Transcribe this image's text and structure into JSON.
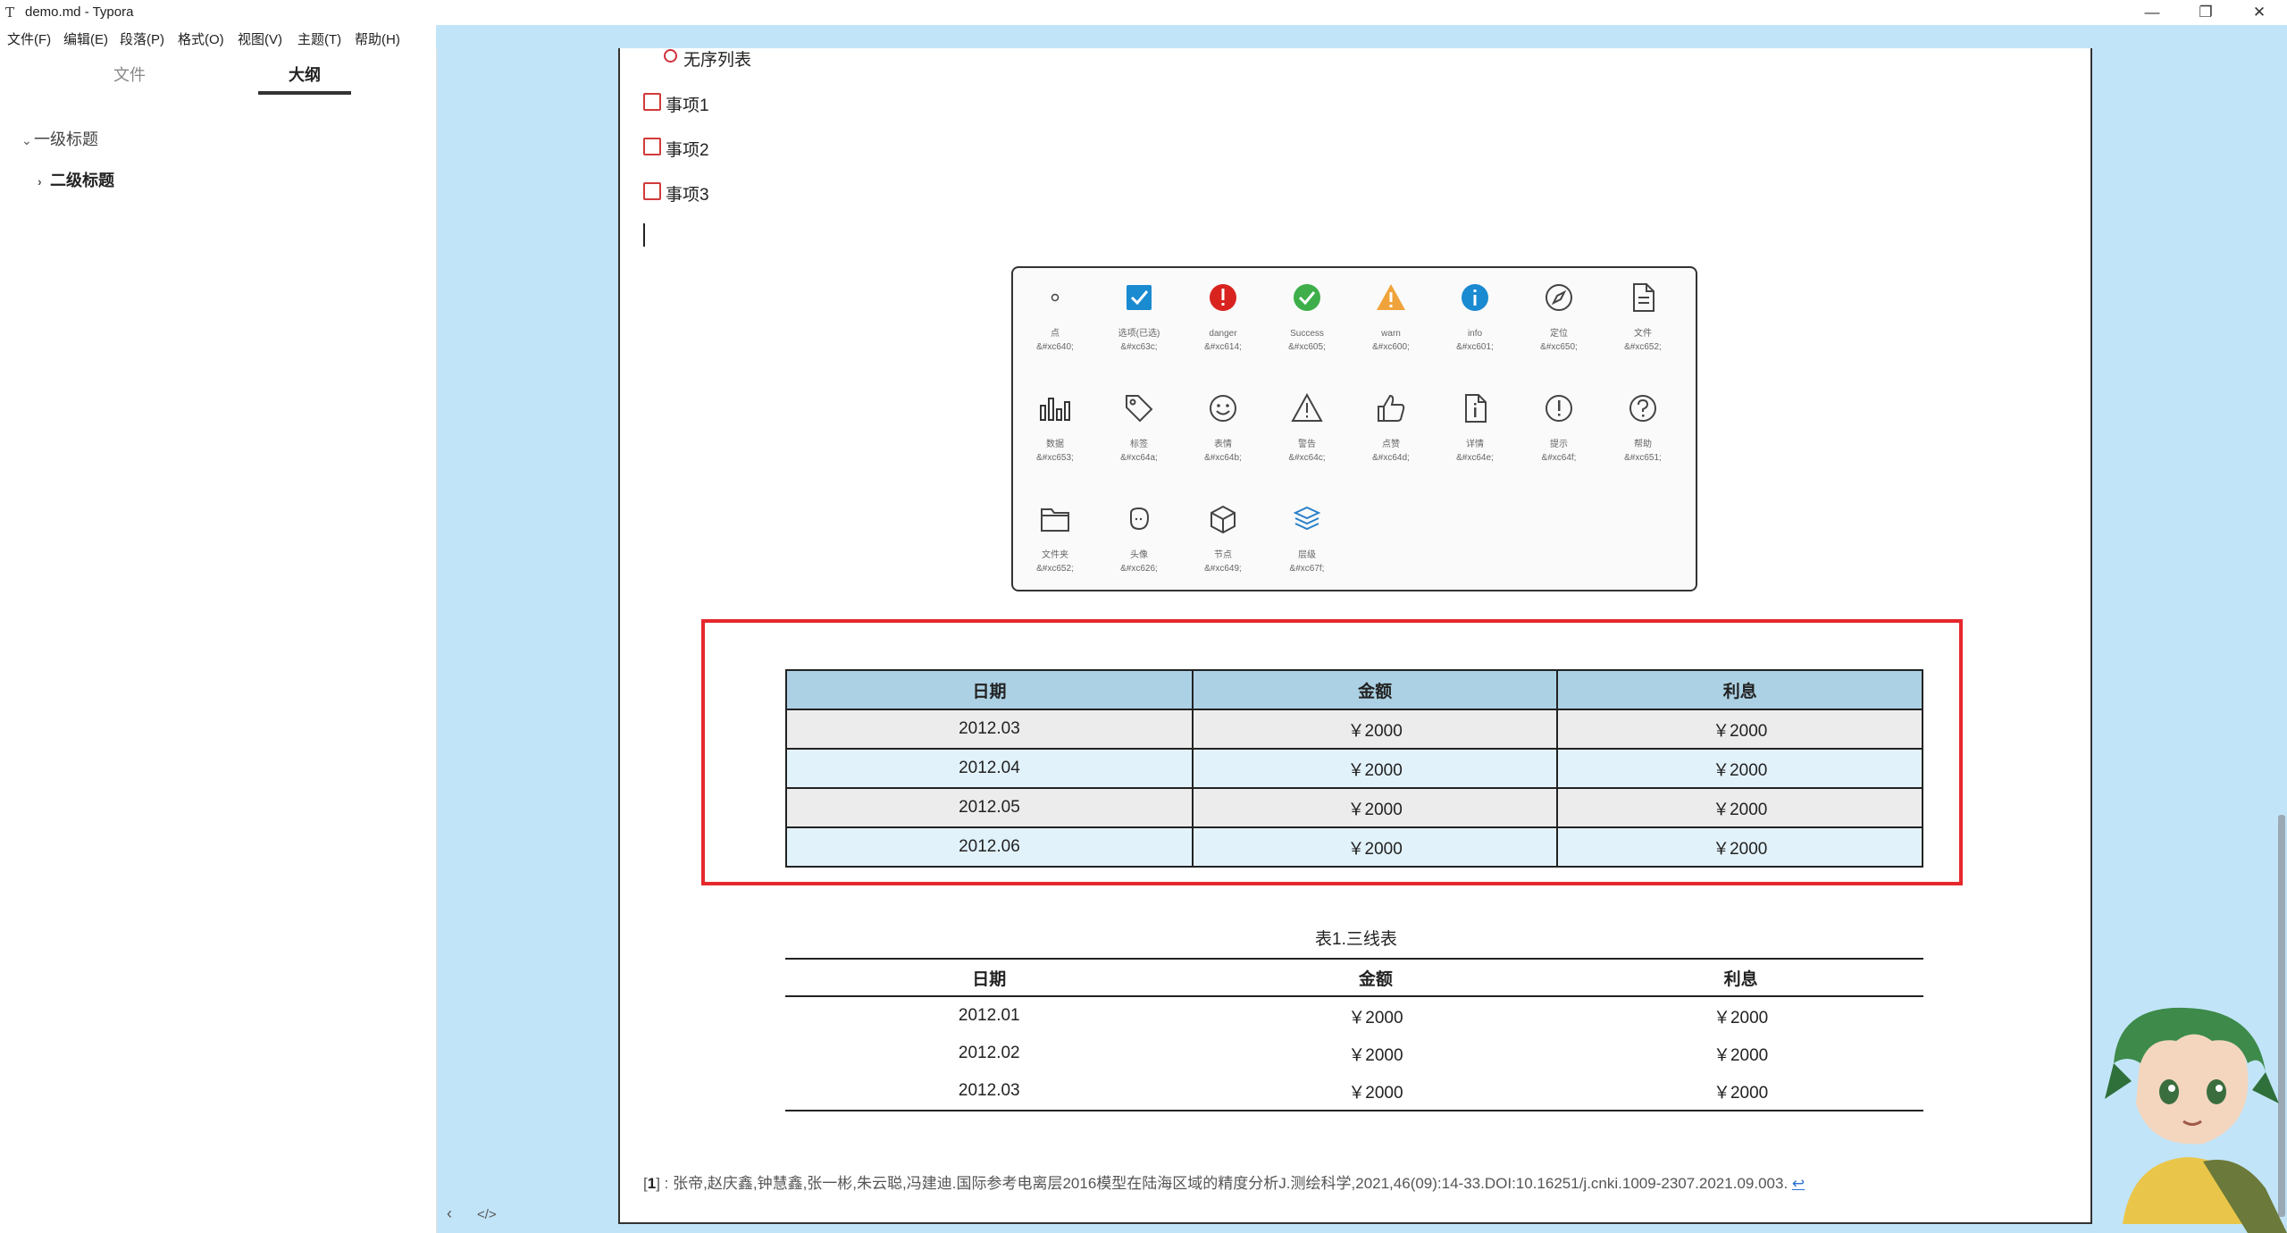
{
  "window": {
    "title": "demo.md - Typora",
    "app_icon": "T",
    "min_glyph": "—",
    "max_glyph": "❐",
    "close_glyph": "✕"
  },
  "menu": [
    "文件(F)",
    "编辑(E)",
    "段落(P)",
    "格式(O)",
    "视图(V)",
    "主题(T)",
    "帮助(H)"
  ],
  "sidebar": {
    "tabs": [
      "文件",
      "大纲"
    ],
    "active_tab": "大纲",
    "outline": [
      {
        "label": "一级标题",
        "chevron": "⌄"
      },
      {
        "label": "二级标题",
        "chevron": "›"
      }
    ],
    "footer_icons": [
      "‹",
      "</>"
    ]
  },
  "editor": {
    "unordered_item": "无序列表",
    "tasks": [
      "事项1",
      "事项2",
      "事项3"
    ],
    "gallery": [
      {
        "label": "点",
        "code": "&#xc640;"
      },
      {
        "label": "选项(已选)",
        "code": "&#xc63c;"
      },
      {
        "label": "danger",
        "code": "&#xc614;"
      },
      {
        "label": "Success",
        "code": "&#xc605;"
      },
      {
        "label": "warn",
        "code": "&#xc600;"
      },
      {
        "label": "info",
        "code": "&#xc601;"
      },
      {
        "label": "定位",
        "code": "&#xc650;"
      },
      {
        "label": "文件",
        "code": "&#xc652;"
      },
      {
        "label": "数据",
        "code": "&#xc653;"
      },
      {
        "label": "标签",
        "code": "&#xc64a;"
      },
      {
        "label": "表情",
        "code": "&#xc64b;"
      },
      {
        "label": "警告",
        "code": "&#xc64c;"
      },
      {
        "label": "点赞",
        "code": "&#xc64d;"
      },
      {
        "label": "详情",
        "code": "&#xc64e;"
      },
      {
        "label": "提示",
        "code": "&#xc64f;"
      },
      {
        "label": "帮助",
        "code": "&#xc651;"
      },
      {
        "label": "文件夹",
        "code": "&#xc652;"
      },
      {
        "label": "头像",
        "code": "&#xc626;"
      },
      {
        "label": "节点",
        "code": "&#xc649;"
      },
      {
        "label": "层级",
        "code": "&#xc67f;"
      }
    ],
    "table1": {
      "headers": [
        "日期",
        "金额",
        "利息"
      ],
      "rows": [
        [
          "2012.03",
          "￥2000",
          "￥2000"
        ],
        [
          "2012.04",
          "￥2000",
          "￥2000"
        ],
        [
          "2012.05",
          "￥2000",
          "￥2000"
        ],
        [
          "2012.06",
          "￥2000",
          "￥2000"
        ]
      ]
    },
    "table2": {
      "caption": "表1.三线表",
      "headers": [
        "日期",
        "金额",
        "利息"
      ],
      "rows": [
        [
          "2012.01",
          "￥2000",
          "￥2000"
        ],
        [
          "2012.02",
          "￥2000",
          "￥2000"
        ],
        [
          "2012.03",
          "￥2000",
          "￥2000"
        ]
      ]
    },
    "footnote": {
      "open": "[",
      "number": "1",
      "close": "]",
      "sep": ":",
      "text": "张帝,赵庆鑫,钟慧鑫,张一彬,朱云聪,冯建迪.国际参考电离层2016模型在陆海区域的精度分析J.测绘科学,2021,46(09):14-33.DOI:10.16251/j.cnki.1009-2307.2021.09.003.",
      "back": "↩"
    }
  },
  "colors": {
    "accent_red": "#e5282c",
    "background": "#c2e4f8",
    "header_blue": "#acd1e4"
  }
}
